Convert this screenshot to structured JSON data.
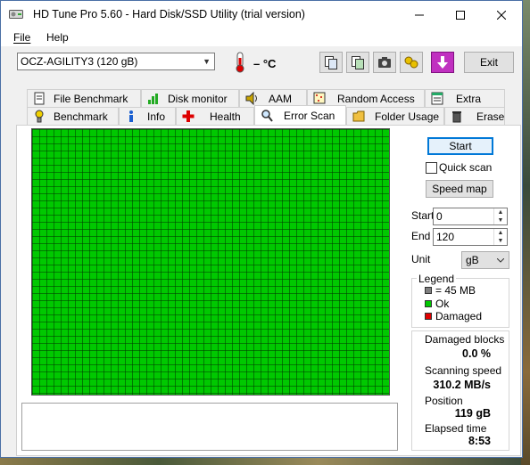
{
  "window": {
    "title": "HD Tune Pro 5.60 - Hard Disk/SSD Utility (trial version)"
  },
  "menu": {
    "file": "File",
    "help": "Help"
  },
  "toolbar": {
    "drive": "OCZ-AGILITY3 (120 gB)",
    "temperature": "– °C",
    "exit_label": "Exit"
  },
  "tabs_row1": [
    "File Benchmark",
    "Disk monitor",
    "AAM",
    "Random Access",
    "Extra tests"
  ],
  "tabs_row2": [
    "Benchmark",
    "Info",
    "Health",
    "Error Scan",
    "Folder Usage",
    "Erase"
  ],
  "active_tab": "Error Scan",
  "scan": {
    "start_button": "Start",
    "quick_scan_label": "Quick scan",
    "quick_scan_checked": false,
    "speed_map_button": "Speed map",
    "start_label": "Start",
    "start_value": "0",
    "end_label": "End",
    "end_value": "120",
    "unit_label": "Unit",
    "unit_value": "gB"
  },
  "legend": {
    "title": "Legend",
    "block_size": "= 45 MB",
    "ok": "Ok",
    "damaged": "Damaged",
    "colors": {
      "block": "#808080",
      "ok": "#00c800",
      "damaged": "#e00000"
    }
  },
  "stats": {
    "damaged_blocks_label": "Damaged blocks",
    "damaged_blocks_value": "0.0 %",
    "scanning_speed_label": "Scanning speed",
    "scanning_speed_value": "310.2 MB/s",
    "position_label": "Position",
    "position_value": "119 gB",
    "elapsed_label": "Elapsed time",
    "elapsed_value": "8:53"
  }
}
